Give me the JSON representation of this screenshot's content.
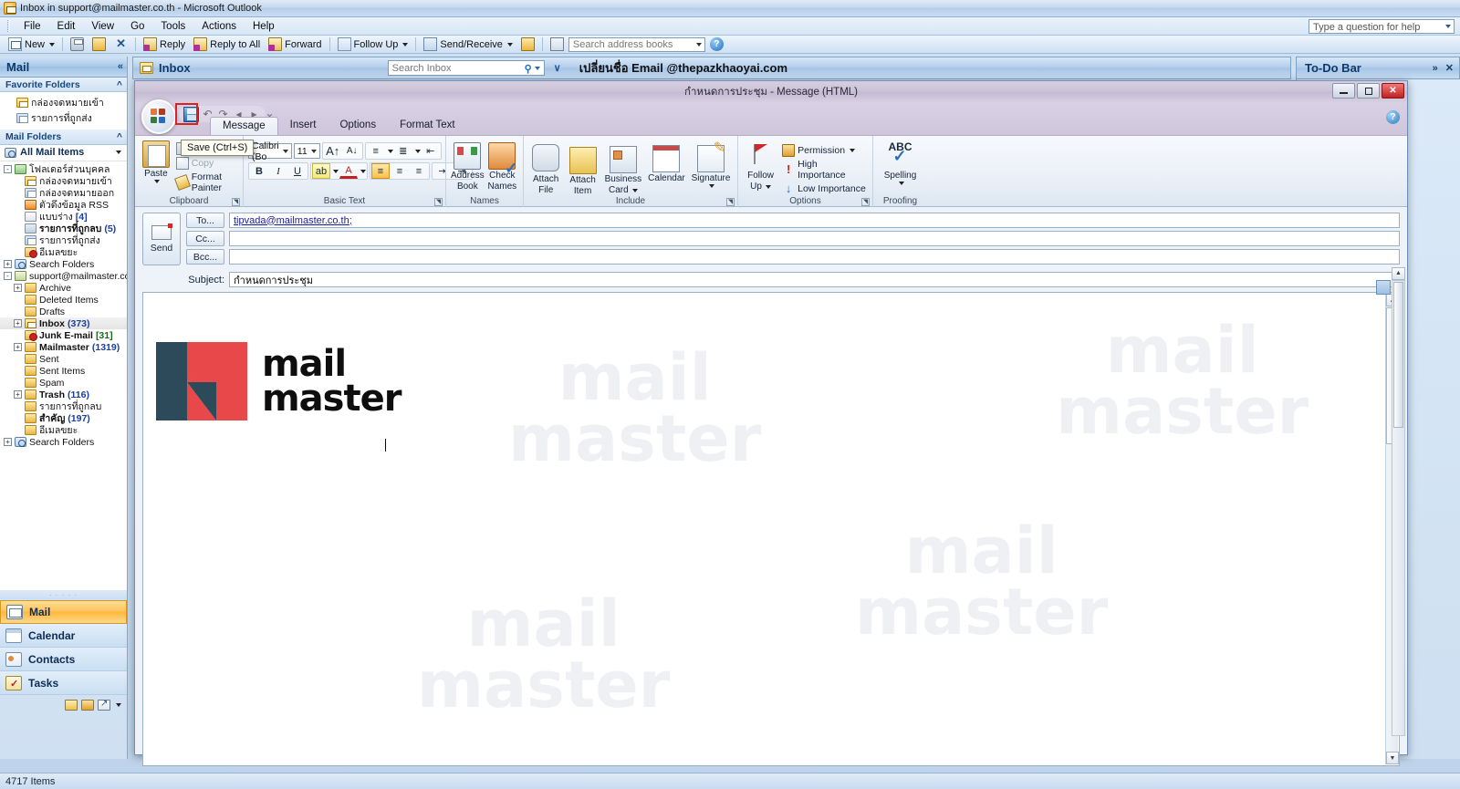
{
  "window": {
    "title": "Inbox in support@mailmaster.co.th - Microsoft Outlook",
    "app_icon": "outlook-icon"
  },
  "menu": {
    "items": [
      "File",
      "Edit",
      "View",
      "Go",
      "Tools",
      "Actions",
      "Help"
    ],
    "help_placeholder": "Type a question for help"
  },
  "toolbar": {
    "new_label": "New",
    "reply_label": "Reply",
    "reply_all_label": "Reply to All",
    "forward_label": "Forward",
    "follow_up_label": "Follow Up",
    "send_receive_label": "Send/Receive",
    "search_address_placeholder": "Search address books"
  },
  "navpane": {
    "header_title": "Mail",
    "collapse_icon": "chevron-left-icon",
    "favorite_folders_label": "Favorite Folders",
    "favorites": [
      {
        "label": "กล่องจดหมายเข้า",
        "icon": "inbox-folder-icon"
      },
      {
        "label": "รายการที่ถูกส่ง",
        "icon": "sent-folder-icon"
      }
    ],
    "mail_folders_label": "Mail Folders",
    "all_mail_items": "All Mail Items",
    "tree": [
      {
        "label": "โฟลเดอร์ส่วนบุคคล",
        "indent": 0,
        "expander": "-",
        "icon": "personal-folders-icon",
        "count": "",
        "bold": false
      },
      {
        "label": "กล่องจดหมายเข้า",
        "indent": 1,
        "expander": "",
        "icon": "inbox-folder-icon",
        "count": "",
        "bold": false
      },
      {
        "label": "กล่องจดหมายออก",
        "indent": 1,
        "expander": "",
        "icon": "outbox-folder-icon",
        "count": "",
        "bold": false
      },
      {
        "label": "ตัวดึงข้อมูล RSS",
        "indent": 1,
        "expander": "",
        "icon": "rss-folder-icon",
        "count": "",
        "bold": false
      },
      {
        "label": "แบบร่าง",
        "indent": 1,
        "expander": "",
        "icon": "drafts-folder-icon",
        "count": "[4]",
        "bold": false
      },
      {
        "label": "รายการที่ถูกลบ",
        "indent": 1,
        "expander": "",
        "icon": "deleted-folder-icon",
        "count": "(5)",
        "bold": true
      },
      {
        "label": "รายการที่ถูกส่ง",
        "indent": 1,
        "expander": "",
        "icon": "sent-folder-icon",
        "count": "",
        "bold": false
      },
      {
        "label": "อีเมลขยะ",
        "indent": 1,
        "expander": "",
        "icon": "junk-folder-icon",
        "count": "",
        "bold": false
      },
      {
        "label": "Search Folders",
        "indent": 0,
        "expander": "+",
        "icon": "search-folder-icon",
        "count": "",
        "bold": false
      },
      {
        "label": "support@mailmaster.co",
        "indent": 0,
        "expander": "-",
        "icon": "account-folder-icon",
        "count": "",
        "bold": false
      },
      {
        "label": "Archive",
        "indent": 1,
        "expander": "+",
        "icon": "plain-folder-icon",
        "count": "",
        "bold": false
      },
      {
        "label": "Deleted Items",
        "indent": 1,
        "expander": "",
        "icon": "plain-folder-icon",
        "count": "",
        "bold": false
      },
      {
        "label": "Drafts",
        "indent": 1,
        "expander": "",
        "icon": "plain-folder-icon",
        "count": "",
        "bold": false
      },
      {
        "label": "Inbox",
        "indent": 1,
        "expander": "+",
        "icon": "inbox-folder-icon",
        "count": "(373)",
        "bold": true,
        "selected": true
      },
      {
        "label": "Junk E-mail",
        "indent": 1,
        "expander": "",
        "icon": "junk-folder-icon",
        "count": "[31]",
        "count_color": "green",
        "bold": true
      },
      {
        "label": "Mailmaster",
        "indent": 1,
        "expander": "+",
        "icon": "plain-folder-icon",
        "count": "(1319)",
        "bold": true
      },
      {
        "label": "Sent",
        "indent": 1,
        "expander": "",
        "icon": "plain-folder-icon",
        "count": "",
        "bold": false
      },
      {
        "label": "Sent Items",
        "indent": 1,
        "expander": "",
        "icon": "plain-folder-icon",
        "count": "",
        "bold": false
      },
      {
        "label": "Spam",
        "indent": 1,
        "expander": "",
        "icon": "plain-folder-icon",
        "count": "",
        "bold": false
      },
      {
        "label": "Trash",
        "indent": 1,
        "expander": "+",
        "icon": "plain-folder-icon",
        "count": "(116)",
        "bold": true
      },
      {
        "label": "รายการที่ถูกลบ",
        "indent": 1,
        "expander": "",
        "icon": "plain-folder-icon",
        "count": "",
        "bold": false
      },
      {
        "label": "สำคัญ",
        "indent": 1,
        "expander": "",
        "icon": "plain-folder-icon",
        "count": "(197)",
        "bold": true
      },
      {
        "label": "อีเมลขยะ",
        "indent": 1,
        "expander": "",
        "icon": "plain-folder-icon",
        "count": "",
        "bold": false
      },
      {
        "label": "Search Folders",
        "indent": 0,
        "expander": "+",
        "icon": "search-folder-icon",
        "count": "",
        "bold": false
      }
    ],
    "buttons": [
      {
        "label": "Mail",
        "icon": "mail-icon",
        "active": true
      },
      {
        "label": "Calendar",
        "icon": "calendar-icon",
        "active": false
      },
      {
        "label": "Contacts",
        "icon": "contacts-icon",
        "active": false
      },
      {
        "label": "Tasks",
        "icon": "tasks-icon",
        "active": false
      }
    ]
  },
  "inbox_header": {
    "title": "Inbox",
    "search_placeholder": "Search Inbox",
    "banner": "เปลี่ยนชื่อ Email @thepazkhaoyai.com"
  },
  "todo_bar": {
    "title": "To-Do Bar",
    "expand_icon": "chevrons-right-icon",
    "close_icon": "close-icon"
  },
  "compose": {
    "title": "กำหนดการประชุม - Message (HTML)",
    "tooltip": "Save (Ctrl+S)",
    "quick_access": {
      "save_icon": "save-icon",
      "undo_icon": "undo-icon",
      "redo_icon": "redo-icon",
      "prev_icon": "previous-item-icon",
      "next_icon": "next-item-icon",
      "customize_icon": "chevron-down-icon"
    },
    "window_controls": {
      "minimize": "minimize-icon",
      "maximize": "maximize-icon",
      "close": "close-icon"
    },
    "tabs": [
      {
        "label": "Message",
        "active": true
      },
      {
        "label": "Insert",
        "active": false
      },
      {
        "label": "Options",
        "active": false
      },
      {
        "label": "Format Text",
        "active": false
      }
    ],
    "ribbon": {
      "clipboard": {
        "group_label": "Clipboard",
        "paste": "Paste",
        "cut": "Cut",
        "copy": "Copy",
        "format_painter": "Format Painter"
      },
      "basic_text": {
        "group_label": "Basic Text",
        "font_name": "Calibri (Bo",
        "font_size": "11",
        "grow_font": "A",
        "shrink_font": "A",
        "bold": "B",
        "italic": "I",
        "underline": "U"
      },
      "names": {
        "group_label": "Names",
        "address_book": "Address\nBook",
        "address_book_l1": "Address",
        "address_book_l2": "Book",
        "check_names_l1": "Check",
        "check_names_l2": "Names"
      },
      "include": {
        "group_label": "Include",
        "attach_file_l1": "Attach",
        "attach_file_l2": "File",
        "attach_item_l1": "Attach",
        "attach_item_l2": "Item",
        "business_card_l1": "Business",
        "business_card_l2": "Card",
        "calendar": "Calendar",
        "signature": "Signature"
      },
      "options": {
        "group_label": "Options",
        "follow_up_l1": "Follow",
        "follow_up_l2": "Up",
        "permission": "Permission",
        "high_importance": "High Importance",
        "low_importance": "Low Importance"
      },
      "proofing": {
        "group_label": "Proofing",
        "spelling": "Spelling",
        "abc": "ABC"
      }
    },
    "fields": {
      "send_label": "Send",
      "to_label": "To...",
      "cc_label": "Cc...",
      "bcc_label": "Bcc...",
      "to_value": "tipvada@mailmaster.co.th;",
      "cc_value": "",
      "bcc_value": "",
      "subject_label": "Subject:",
      "subject_value": "กำหนดการประชุม"
    },
    "body": {
      "logo_line1": "mail",
      "logo_line2": "master",
      "logo_color_dark": "#2d4a5a",
      "logo_color_red": "#e8484a"
    }
  },
  "status_bar": {
    "items_count": "4717 Items"
  },
  "watermark": {
    "line1": "mail",
    "line2": "master"
  }
}
